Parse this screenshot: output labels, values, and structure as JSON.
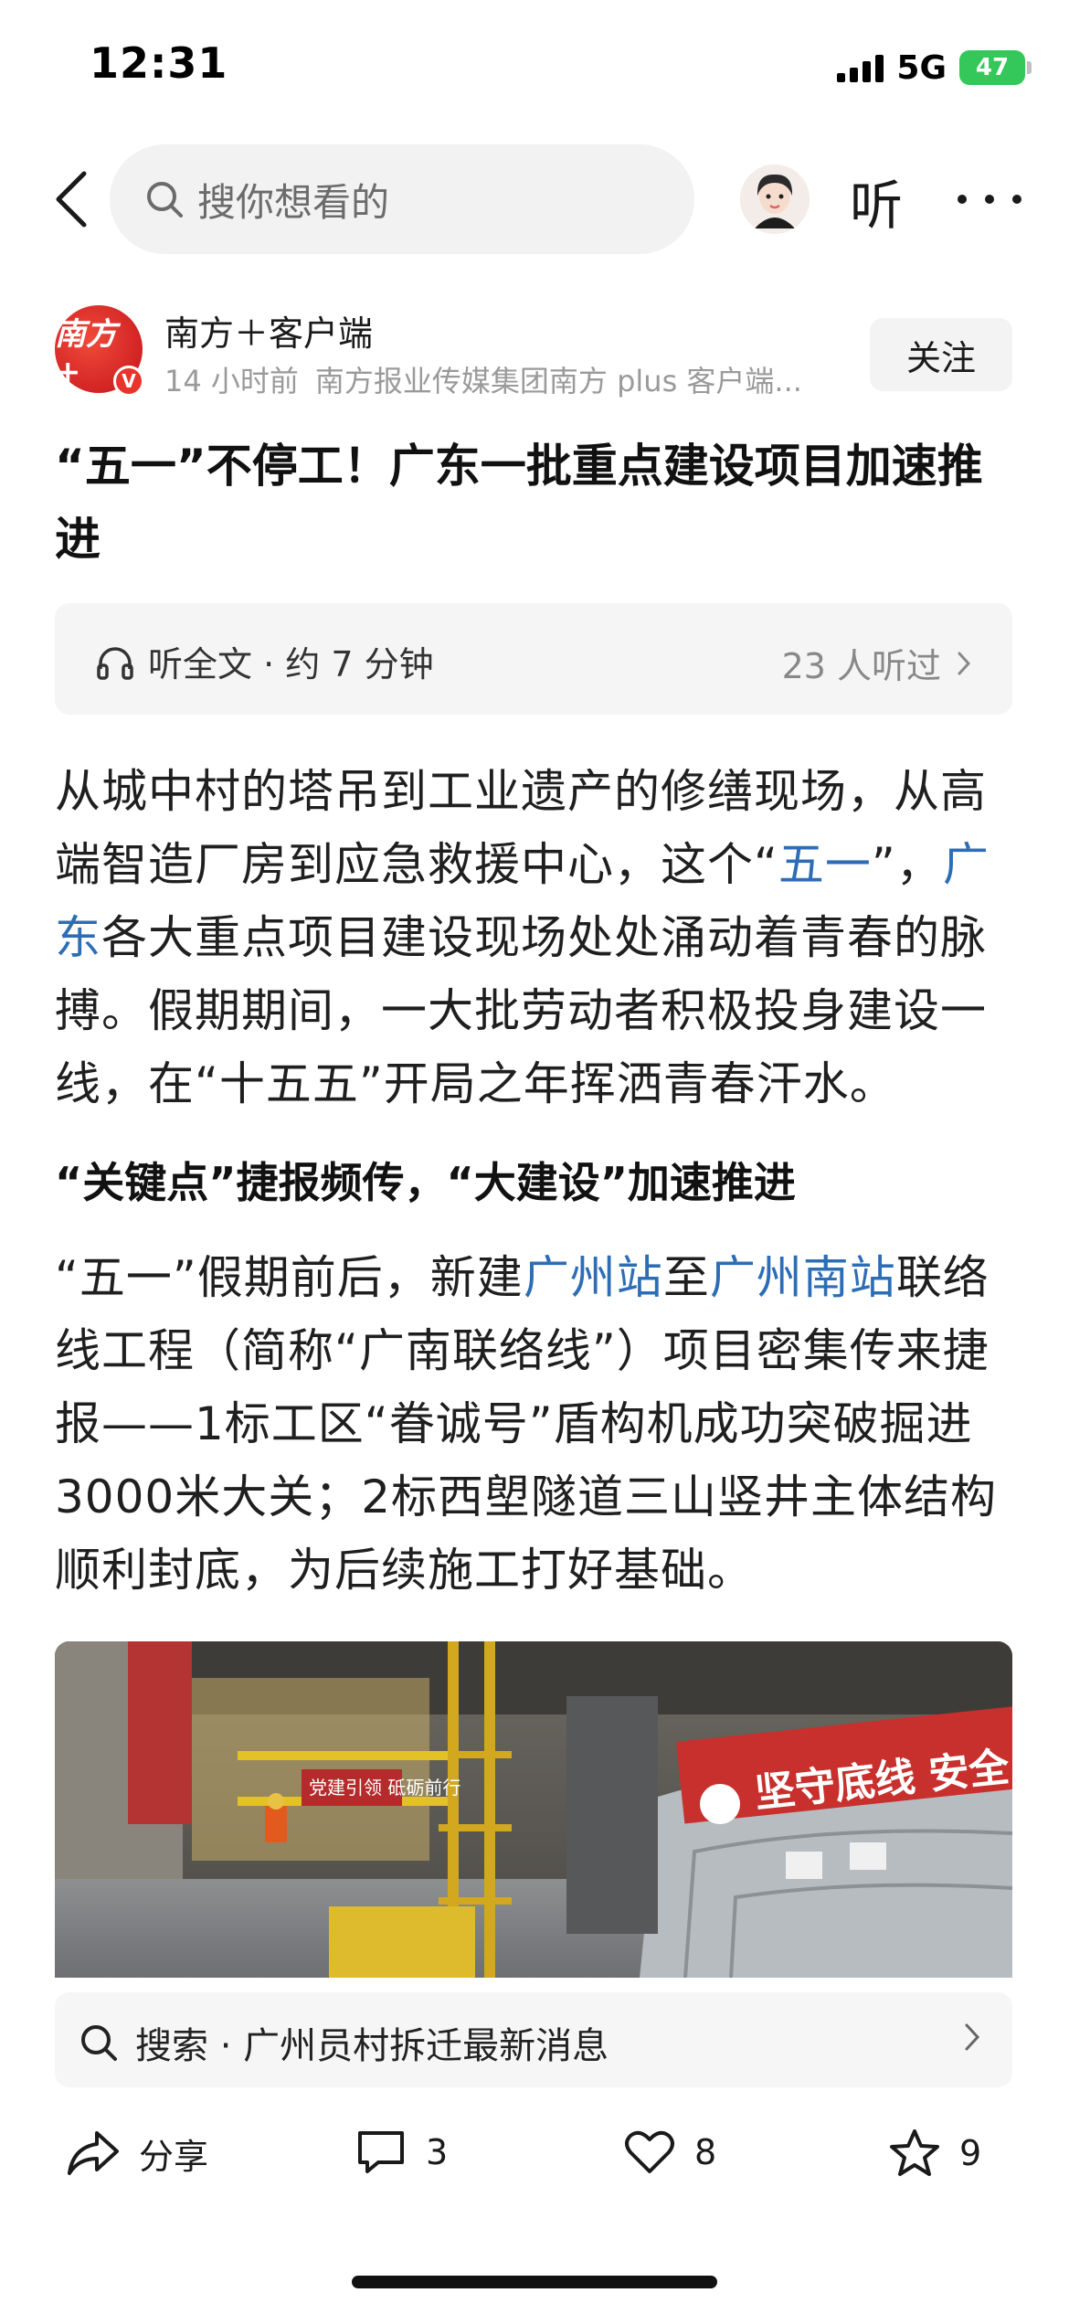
{
  "status_bar": {
    "time": "12:31",
    "network": "5G",
    "battery": "47"
  },
  "nav": {
    "search_placeholder": "搜你想看的",
    "listen_label": "听"
  },
  "author": {
    "logo_text": "南方+",
    "badge": "V",
    "name": "南方＋客户端",
    "time_ago": "14 小时前",
    "source": "南方报业传媒集团南方 plus 客户端...",
    "follow_label": "关注"
  },
  "article": {
    "title": "“五一”不停工！广东一批重点建设项目加速推进",
    "listen_full": "听全文 · 约 7 分钟",
    "listened_count": "23 人听过",
    "para1": {
      "part1": "从城中村的塔吊到工业遗产的修缮现场，从高端智造厂房到应急救援中心，这个“",
      "link1": "五一",
      "part2": "”，",
      "link2": "广东",
      "part3": "各大重点项目建设现场处处涌动着青春的脉搏。假期期间，一大批劳动者积极投身建设一线，在“十五五”开局之年挥洒青春汗水。"
    },
    "subheading": "“关键点”捷报频传，“大建设”加速推进",
    "para2": {
      "part1": "“五一”假期前后，新建",
      "link1": "广州站",
      "part2": "至",
      "link2": "广州南站",
      "part3": "联络线工程（简称“广南联络线”）项目密集传来捷报——1标工区“眷诚号”盾构机成功突破掘进3000米大关；2标西塱隧道三山竖井主体结构顺利封底，为后续施工打好基础。"
    },
    "image_signs": {
      "banner_right": "坚守底线 安全",
      "banner_left": "党建引领 砥砺前行"
    }
  },
  "search_suggestion": {
    "label": "搜索 · 广州员村拆迁最新消息"
  },
  "actions": {
    "share": "分享",
    "comments": "3",
    "likes": "8",
    "favorites": "9"
  },
  "colors": {
    "link": "#2d6db5",
    "battery": "#34c759",
    "brand_red": "#d9251d"
  }
}
